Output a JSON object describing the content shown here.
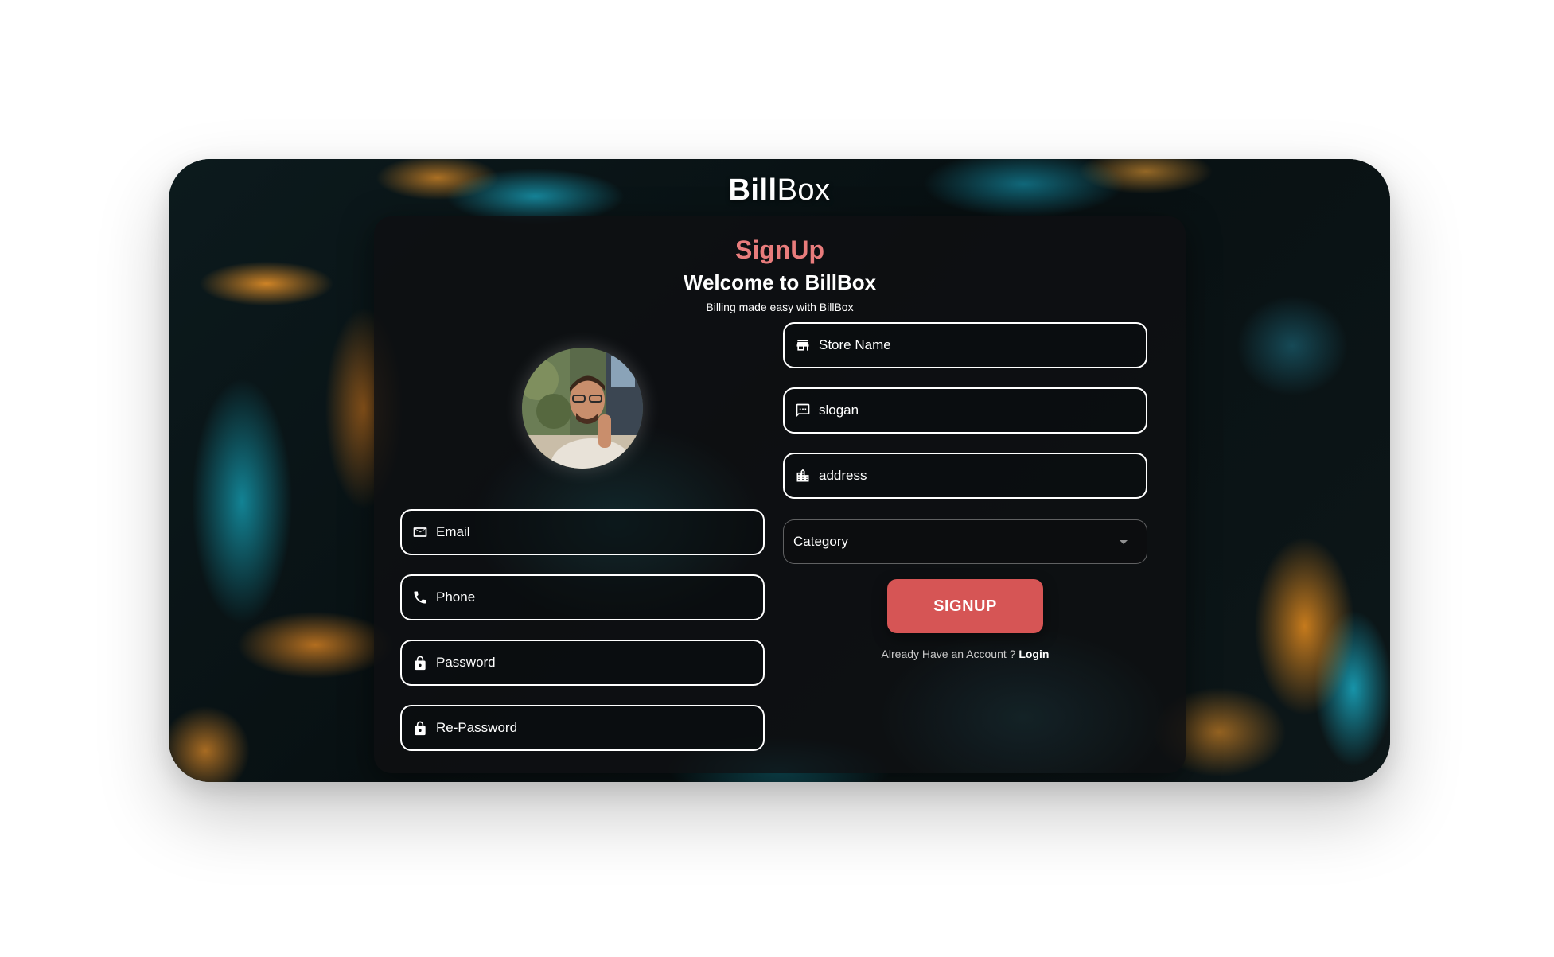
{
  "brand": {
    "bold": "Bill",
    "light": "Box"
  },
  "form": {
    "heading": "SignUp",
    "welcome": "Welcome to BillBox",
    "tagline": "Billing made easy with BillBox"
  },
  "left_fields": [
    {
      "placeholder": "Email",
      "icon": "mail-icon"
    },
    {
      "placeholder": "Phone",
      "icon": "phone-icon"
    },
    {
      "placeholder": "Password",
      "icon": "lock-icon"
    },
    {
      "placeholder": "Re-Password",
      "icon": "lock-icon"
    }
  ],
  "right_fields": [
    {
      "placeholder": "Store Name",
      "icon": "store-icon"
    },
    {
      "placeholder": "slogan",
      "icon": "message-icon"
    },
    {
      "placeholder": "address",
      "icon": "building-icon"
    }
  ],
  "category": {
    "label": "Category"
  },
  "signup_button": "SIGNUP",
  "footer": {
    "prompt": "Already Have an Account ?",
    "login_link": "Login"
  },
  "colors": {
    "accent": "#d65555",
    "heading": "#e87c7c",
    "card_bg": "#0e1012",
    "field_border": "#ffffff"
  }
}
